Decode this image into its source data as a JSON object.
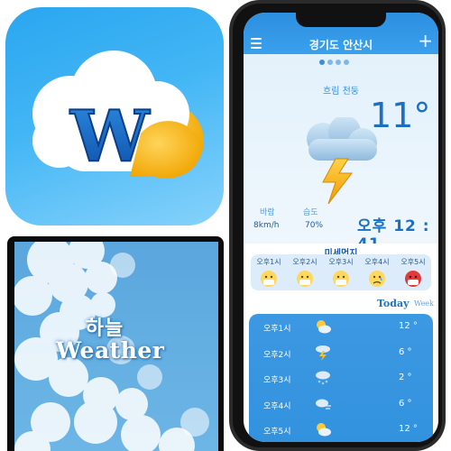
{
  "app_icon": {
    "letter": "W"
  },
  "splash": {
    "title_ko": "하늘",
    "title_en": "Weather"
  },
  "header": {
    "city": "경기도 안산시",
    "menu_icon": "hamburger-menu-icon",
    "add_icon": "plus-icon"
  },
  "current": {
    "page_dots": 4,
    "active_dot": 0,
    "condition": "흐림 천둥",
    "temperature": "11°",
    "wind_label": "바람",
    "wind_value": "8km/h",
    "humidity_label": "습도",
    "humidity_value": "70%",
    "time": "오후 12 : 41"
  },
  "fine_dust": {
    "title": "미세먼지",
    "items": [
      {
        "time": "오후1시",
        "face": "very-good"
      },
      {
        "time": "오후2시",
        "face": "good"
      },
      {
        "time": "오후3시",
        "face": "normal"
      },
      {
        "time": "오후4시",
        "face": "bad"
      },
      {
        "time": "오후5시",
        "face": "very-bad"
      }
    ]
  },
  "tabs": {
    "today": "Today",
    "week": "Week"
  },
  "hourly": [
    {
      "time": "오후1시",
      "icon": "partly-cloudy-icon",
      "temp": "12 °"
    },
    {
      "time": "오후2시",
      "icon": "thunder-icon",
      "temp": "6 °"
    },
    {
      "time": "오후3시",
      "icon": "rain-cloud-icon",
      "temp": "2 °"
    },
    {
      "time": "오후4시",
      "icon": "cloudy-wind-icon",
      "temp": "6 °"
    },
    {
      "time": "오후5시",
      "icon": "partly-cloudy-icon",
      "temp": "12 °"
    }
  ],
  "colors": {
    "brand_blue": "#3aa0ec",
    "accent_dark_blue": "#1d6fbf",
    "lightning_yellow": "#f5b400"
  }
}
